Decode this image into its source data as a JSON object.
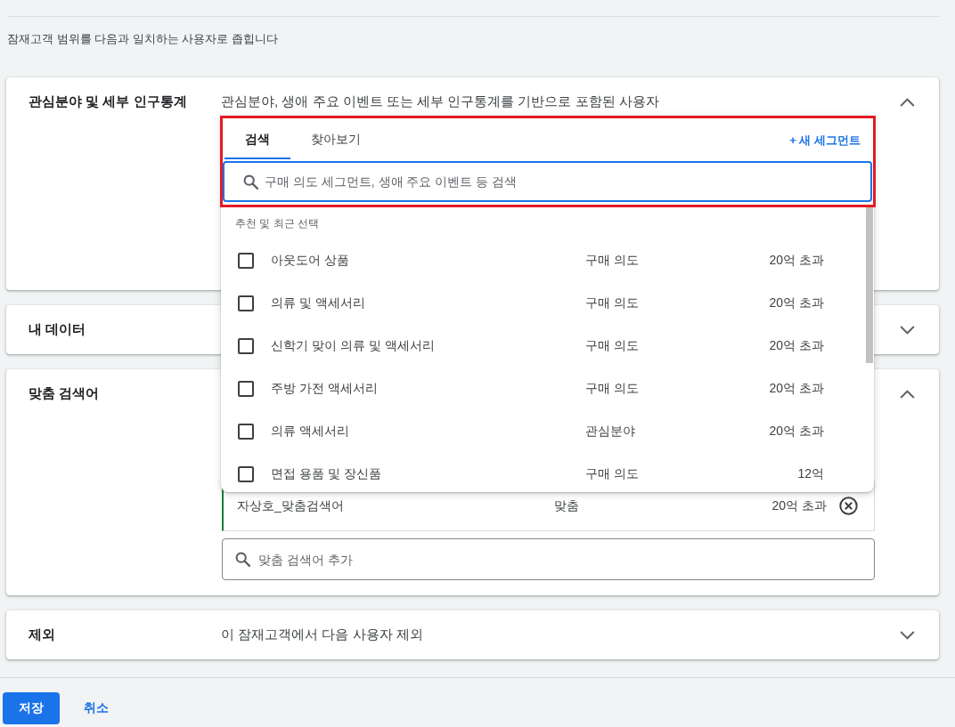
{
  "intro": "잠재고객 범위를 다음과 일치하는 사용자로 좁힙니다",
  "sections": [
    {
      "title": "관심분야 및 세부 인구통계",
      "description": "관심분야, 생애 주요 이벤트 또는 세부 인구통계를 기반으로 포함된 사용자",
      "expanded": true,
      "segment_picker": {
        "highlighted": true,
        "tabs": [
          {
            "label": "검색",
            "selected": true
          },
          {
            "label": "찾아보기",
            "selected": false
          }
        ],
        "new_segment": "+ 새 세그먼트",
        "search": {
          "placeholder": "구매 의도 세그먼트, 생애 주요 이벤트 등 검색"
        },
        "list_heading": "추천 및 최근 선택",
        "rows": [
          {
            "name": "아웃도어 상품",
            "type": "구매 의도",
            "size": "20억 초과",
            "checked": false
          },
          {
            "name": "의류 및 액세서리",
            "type": "구매 의도",
            "size": "20억 초과",
            "checked": false
          },
          {
            "name": "신학기 맞이 의류 및 액세서리",
            "type": "구매 의도",
            "size": "20억 초과",
            "checked": false
          },
          {
            "name": "주방 가전 액세서리",
            "type": "구매 의도",
            "size": "20억 초과",
            "checked": false
          },
          {
            "name": "의류 액세서리",
            "type": "관심분야",
            "size": "20억 초과",
            "checked": false
          },
          {
            "name": "면접 용품 및 장신품",
            "type": "구매 의도",
            "size": "12억",
            "checked": false
          }
        ]
      }
    },
    {
      "title": "내 데이터",
      "expanded": false
    },
    {
      "title": "맞춤 검색어",
      "expanded": true,
      "selected_segments": [
        {
          "name": "자상호_맞춤검색어",
          "type": "맞춤",
          "size": "20억 초과"
        }
      ],
      "search": {
        "placeholder": "맞춤 검색어 추가"
      }
    },
    {
      "title": "제외",
      "description": "이 잠재고객에서 다음 사용자 제외",
      "expanded": false
    }
  ],
  "footer": {
    "buttons": [
      {
        "label": "저장",
        "kind": "primary"
      },
      {
        "label": "취소",
        "kind": "text"
      }
    ]
  }
}
